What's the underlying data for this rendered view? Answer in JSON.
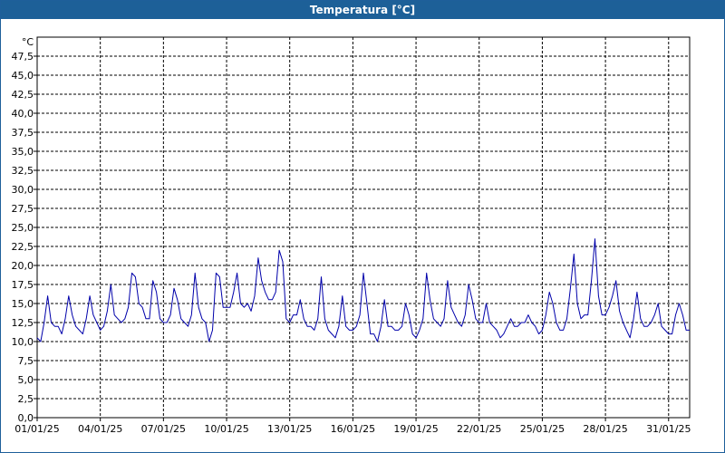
{
  "window": {
    "title": "Temperatura [°C]"
  },
  "colors": {
    "titlebar": "#1d6098",
    "series": "#0000aa",
    "grid": "#000000",
    "background": "#ffffff"
  },
  "chart_data": {
    "type": "line",
    "title": "Temperatura [°C]",
    "ylabel": "°C",
    "xlabel": "",
    "ylim": [
      0,
      50
    ],
    "xlim": [
      "2025-01-01",
      "2025-02-01"
    ],
    "grid": true,
    "y_ticks": [
      "0,0",
      "2,5",
      "5,0",
      "7,5",
      "10,0",
      "12,5",
      "15,0",
      "17,5",
      "20,0",
      "22,5",
      "25,0",
      "27,5",
      "30,0",
      "32,5",
      "35,0",
      "37,5",
      "40,0",
      "42,5",
      "45,0",
      "47,5"
    ],
    "x_ticks": [
      "01/01/25",
      "04/01/25",
      "07/01/25",
      "10/01/25",
      "13/01/25",
      "16/01/25",
      "19/01/25",
      "22/01/25",
      "25/01/25",
      "28/01/25",
      "31/01/25"
    ],
    "series": [
      {
        "values": [
          {
            "x": "2025-01-01T00:00",
            "y": 10.5
          },
          {
            "x": "2025-01-01T04:00",
            "y": 10.0
          },
          {
            "x": "2025-01-01T08:00",
            "y": 12.5
          },
          {
            "x": "2025-01-01T12:00",
            "y": 16.0
          },
          {
            "x": "2025-01-01T16:00",
            "y": 12.5
          },
          {
            "x": "2025-01-01T20:00",
            "y": 12.0
          },
          {
            "x": "2025-01-02T00:00",
            "y": 12.0
          },
          {
            "x": "2025-01-02T04:00",
            "y": 11.0
          },
          {
            "x": "2025-01-02T08:00",
            "y": 13.0
          },
          {
            "x": "2025-01-02T12:00",
            "y": 16.0
          },
          {
            "x": "2025-01-02T16:00",
            "y": 13.5
          },
          {
            "x": "2025-01-02T20:00",
            "y": 12.0
          },
          {
            "x": "2025-01-03T00:00",
            "y": 11.5
          },
          {
            "x": "2025-01-03T04:00",
            "y": 11.0
          },
          {
            "x": "2025-01-03T08:00",
            "y": 13.0
          },
          {
            "x": "2025-01-03T12:00",
            "y": 16.0
          },
          {
            "x": "2025-01-03T16:00",
            "y": 13.5
          },
          {
            "x": "2025-01-03T20:00",
            "y": 12.5
          },
          {
            "x": "2025-01-04T00:00",
            "y": 11.5
          },
          {
            "x": "2025-01-04T04:00",
            "y": 12.0
          },
          {
            "x": "2025-01-04T08:00",
            "y": 14.0
          },
          {
            "x": "2025-01-04T12:00",
            "y": 17.5
          },
          {
            "x": "2025-01-04T16:00",
            "y": 13.5
          },
          {
            "x": "2025-01-04T20:00",
            "y": 13.0
          },
          {
            "x": "2025-01-05T00:00",
            "y": 12.5
          },
          {
            "x": "2025-01-05T04:00",
            "y": 13.0
          },
          {
            "x": "2025-01-05T08:00",
            "y": 14.5
          },
          {
            "x": "2025-01-05T12:00",
            "y": 19.0
          },
          {
            "x": "2025-01-05T16:00",
            "y": 18.5
          },
          {
            "x": "2025-01-05T20:00",
            "y": 15.0
          },
          {
            "x": "2025-01-06T00:00",
            "y": 14.5
          },
          {
            "x": "2025-01-06T04:00",
            "y": 13.0
          },
          {
            "x": "2025-01-06T08:00",
            "y": 13.0
          },
          {
            "x": "2025-01-06T12:00",
            "y": 18.0
          },
          {
            "x": "2025-01-06T16:00",
            "y": 16.5
          },
          {
            "x": "2025-01-06T20:00",
            "y": 13.0
          },
          {
            "x": "2025-01-07T00:00",
            "y": 12.5
          },
          {
            "x": "2025-01-07T04:00",
            "y": 12.5
          },
          {
            "x": "2025-01-07T08:00",
            "y": 13.5
          },
          {
            "x": "2025-01-07T12:00",
            "y": 17.0
          },
          {
            "x": "2025-01-07T16:00",
            "y": 15.5
          },
          {
            "x": "2025-01-07T20:00",
            "y": 13.0
          },
          {
            "x": "2025-01-08T00:00",
            "y": 12.5
          },
          {
            "x": "2025-01-08T04:00",
            "y": 12.0
          },
          {
            "x": "2025-01-08T08:00",
            "y": 13.5
          },
          {
            "x": "2025-01-08T12:00",
            "y": 19.0
          },
          {
            "x": "2025-01-08T16:00",
            "y": 14.5
          },
          {
            "x": "2025-01-08T20:00",
            "y": 13.0
          },
          {
            "x": "2025-01-09T00:00",
            "y": 12.5
          },
          {
            "x": "2025-01-09T04:00",
            "y": 10.0
          },
          {
            "x": "2025-01-09T08:00",
            "y": 11.5
          },
          {
            "x": "2025-01-09T12:00",
            "y": 19.0
          },
          {
            "x": "2025-01-09T16:00",
            "y": 18.5
          },
          {
            "x": "2025-01-09T20:00",
            "y": 14.5
          },
          {
            "x": "2025-01-10T00:00",
            "y": 14.5
          },
          {
            "x": "2025-01-10T04:00",
            "y": 14.5
          },
          {
            "x": "2025-01-10T08:00",
            "y": 16.5
          },
          {
            "x": "2025-01-10T12:00",
            "y": 19.0
          },
          {
            "x": "2025-01-10T16:00",
            "y": 15.0
          },
          {
            "x": "2025-01-10T20:00",
            "y": 14.5
          },
          {
            "x": "2025-01-11T00:00",
            "y": 15.0
          },
          {
            "x": "2025-01-11T04:00",
            "y": 14.0
          },
          {
            "x": "2025-01-11T08:00",
            "y": 16.0
          },
          {
            "x": "2025-01-11T12:00",
            "y": 21.0
          },
          {
            "x": "2025-01-11T16:00",
            "y": 18.0
          },
          {
            "x": "2025-01-11T20:00",
            "y": 16.5
          },
          {
            "x": "2025-01-12T00:00",
            "y": 15.5
          },
          {
            "x": "2025-01-12T04:00",
            "y": 15.5
          },
          {
            "x": "2025-01-12T08:00",
            "y": 16.5
          },
          {
            "x": "2025-01-12T12:00",
            "y": 22.0
          },
          {
            "x": "2025-01-12T16:00",
            "y": 20.5
          },
          {
            "x": "2025-01-12T20:00",
            "y": 13.0
          },
          {
            "x": "2025-01-13T00:00",
            "y": 12.5
          },
          {
            "x": "2025-01-13T04:00",
            "y": 13.5
          },
          {
            "x": "2025-01-13T08:00",
            "y": 13.5
          },
          {
            "x": "2025-01-13T12:00",
            "y": 15.5
          },
          {
            "x": "2025-01-13T16:00",
            "y": 13.0
          },
          {
            "x": "2025-01-13T20:00",
            "y": 12.0
          },
          {
            "x": "2025-01-14T00:00",
            "y": 12.0
          },
          {
            "x": "2025-01-14T04:00",
            "y": 11.5
          },
          {
            "x": "2025-01-14T08:00",
            "y": 13.0
          },
          {
            "x": "2025-01-14T12:00",
            "y": 18.5
          },
          {
            "x": "2025-01-14T16:00",
            "y": 13.0
          },
          {
            "x": "2025-01-14T20:00",
            "y": 11.5
          },
          {
            "x": "2025-01-15T00:00",
            "y": 11.0
          },
          {
            "x": "2025-01-15T04:00",
            "y": 10.5
          },
          {
            "x": "2025-01-15T08:00",
            "y": 12.0
          },
          {
            "x": "2025-01-15T12:00",
            "y": 16.0
          },
          {
            "x": "2025-01-15T16:00",
            "y": 12.0
          },
          {
            "x": "2025-01-15T20:00",
            "y": 11.5
          },
          {
            "x": "2025-01-16T00:00",
            "y": 11.5
          },
          {
            "x": "2025-01-16T04:00",
            "y": 12.0
          },
          {
            "x": "2025-01-16T08:00",
            "y": 13.5
          },
          {
            "x": "2025-01-16T12:00",
            "y": 19.0
          },
          {
            "x": "2025-01-16T16:00",
            "y": 15.0
          },
          {
            "x": "2025-01-16T20:00",
            "y": 11.0
          },
          {
            "x": "2025-01-17T00:00",
            "y": 11.0
          },
          {
            "x": "2025-01-17T04:00",
            "y": 10.0
          },
          {
            "x": "2025-01-17T08:00",
            "y": 12.0
          },
          {
            "x": "2025-01-17T12:00",
            "y": 15.5
          },
          {
            "x": "2025-01-17T16:00",
            "y": 12.0
          },
          {
            "x": "2025-01-17T20:00",
            "y": 12.0
          },
          {
            "x": "2025-01-18T00:00",
            "y": 11.5
          },
          {
            "x": "2025-01-18T04:00",
            "y": 11.5
          },
          {
            "x": "2025-01-18T08:00",
            "y": 12.0
          },
          {
            "x": "2025-01-18T12:00",
            "y": 15.0
          },
          {
            "x": "2025-01-18T16:00",
            "y": 13.5
          },
          {
            "x": "2025-01-18T20:00",
            "y": 11.0
          },
          {
            "x": "2025-01-19T00:00",
            "y": 10.5
          },
          {
            "x": "2025-01-19T04:00",
            "y": 11.5
          },
          {
            "x": "2025-01-19T08:00",
            "y": 13.0
          },
          {
            "x": "2025-01-19T12:00",
            "y": 19.0
          },
          {
            "x": "2025-01-19T16:00",
            "y": 15.5
          },
          {
            "x": "2025-01-19T20:00",
            "y": 13.0
          },
          {
            "x": "2025-01-20T00:00",
            "y": 12.5
          },
          {
            "x": "2025-01-20T04:00",
            "y": 12.0
          },
          {
            "x": "2025-01-20T08:00",
            "y": 13.0
          },
          {
            "x": "2025-01-20T12:00",
            "y": 18.0
          },
          {
            "x": "2025-01-20T16:00",
            "y": 14.5
          },
          {
            "x": "2025-01-20T20:00",
            "y": 13.5
          },
          {
            "x": "2025-01-21T00:00",
            "y": 12.5
          },
          {
            "x": "2025-01-21T04:00",
            "y": 12.0
          },
          {
            "x": "2025-01-21T08:00",
            "y": 13.5
          },
          {
            "x": "2025-01-21T12:00",
            "y": 17.5
          },
          {
            "x": "2025-01-21T16:00",
            "y": 15.5
          },
          {
            "x": "2025-01-21T20:00",
            "y": 13.0
          },
          {
            "x": "2025-01-22T00:00",
            "y": 12.5
          },
          {
            "x": "2025-01-22T04:00",
            "y": 12.5
          },
          {
            "x": "2025-01-22T08:00",
            "y": 15.0
          },
          {
            "x": "2025-01-22T12:00",
            "y": 12.5
          },
          {
            "x": "2025-01-22T16:00",
            "y": 12.0
          },
          {
            "x": "2025-01-22T20:00",
            "y": 11.5
          },
          {
            "x": "2025-01-23T00:00",
            "y": 10.5
          },
          {
            "x": "2025-01-23T04:00",
            "y": 11.0
          },
          {
            "x": "2025-01-23T08:00",
            "y": 12.0
          },
          {
            "x": "2025-01-23T12:00",
            "y": 13.0
          },
          {
            "x": "2025-01-23T16:00",
            "y": 12.0
          },
          {
            "x": "2025-01-23T20:00",
            "y": 12.0
          },
          {
            "x": "2025-01-24T00:00",
            "y": 12.5
          },
          {
            "x": "2025-01-24T04:00",
            "y": 12.5
          },
          {
            "x": "2025-01-24T08:00",
            "y": 13.5
          },
          {
            "x": "2025-01-24T12:00",
            "y": 12.5
          },
          {
            "x": "2025-01-24T16:00",
            "y": 12.0
          },
          {
            "x": "2025-01-24T20:00",
            "y": 11.0
          },
          {
            "x": "2025-01-25T00:00",
            "y": 11.5
          },
          {
            "x": "2025-01-25T04:00",
            "y": 13.5
          },
          {
            "x": "2025-01-25T08:00",
            "y": 16.5
          },
          {
            "x": "2025-01-25T12:00",
            "y": 15.0
          },
          {
            "x": "2025-01-25T16:00",
            "y": 12.5
          },
          {
            "x": "2025-01-25T20:00",
            "y": 11.5
          },
          {
            "x": "2025-01-26T00:00",
            "y": 11.5
          },
          {
            "x": "2025-01-26T04:00",
            "y": 13.0
          },
          {
            "x": "2025-01-26T08:00",
            "y": 17.0
          },
          {
            "x": "2025-01-26T12:00",
            "y": 21.5
          },
          {
            "x": "2025-01-26T16:00",
            "y": 15.0
          },
          {
            "x": "2025-01-26T20:00",
            "y": 13.0
          },
          {
            "x": "2025-01-27T00:00",
            "y": 13.5
          },
          {
            "x": "2025-01-27T04:00",
            "y": 13.5
          },
          {
            "x": "2025-01-27T08:00",
            "y": 18.0
          },
          {
            "x": "2025-01-27T12:00",
            "y": 23.5
          },
          {
            "x": "2025-01-27T16:00",
            "y": 16.0
          },
          {
            "x": "2025-01-27T20:00",
            "y": 13.5
          },
          {
            "x": "2025-01-28T00:00",
            "y": 13.5
          },
          {
            "x": "2025-01-28T04:00",
            "y": 14.5
          },
          {
            "x": "2025-01-28T08:00",
            "y": 16.0
          },
          {
            "x": "2025-01-28T12:00",
            "y": 18.0
          },
          {
            "x": "2025-01-28T16:00",
            "y": 14.0
          },
          {
            "x": "2025-01-28T20:00",
            "y": 12.5
          },
          {
            "x": "2025-01-29T00:00",
            "y": 11.5
          },
          {
            "x": "2025-01-29T04:00",
            "y": 10.5
          },
          {
            "x": "2025-01-29T08:00",
            "y": 13.0
          },
          {
            "x": "2025-01-29T12:00",
            "y": 16.5
          },
          {
            "x": "2025-01-29T16:00",
            "y": 13.0
          },
          {
            "x": "2025-01-29T20:00",
            "y": 12.0
          },
          {
            "x": "2025-01-30T00:00",
            "y": 12.0
          },
          {
            "x": "2025-01-30T04:00",
            "y": 12.5
          },
          {
            "x": "2025-01-30T08:00",
            "y": 13.5
          },
          {
            "x": "2025-01-30T12:00",
            "y": 15.0
          },
          {
            "x": "2025-01-30T16:00",
            "y": 12.0
          },
          {
            "x": "2025-01-30T20:00",
            "y": 11.5
          },
          {
            "x": "2025-01-31T00:00",
            "y": 11.0
          },
          {
            "x": "2025-01-31T04:00",
            "y": 11.0
          },
          {
            "x": "2025-01-31T08:00",
            "y": 13.5
          },
          {
            "x": "2025-01-31T12:00",
            "y": 15.0
          },
          {
            "x": "2025-01-31T16:00",
            "y": 13.5
          },
          {
            "x": "2025-01-31T20:00",
            "y": 11.5
          },
          {
            "x": "2025-02-01T00:00",
            "y": 11.5
          }
        ]
      }
    ]
  }
}
